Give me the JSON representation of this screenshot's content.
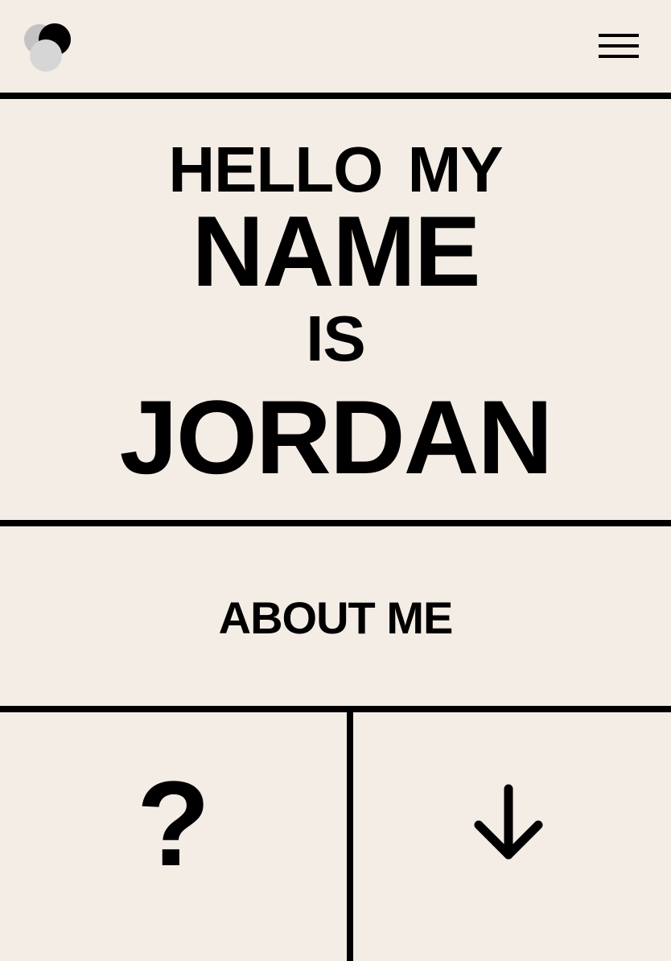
{
  "header": {
    "logo_icon": "overlapping-circles-logo",
    "menu_icon": "hamburger-menu-icon"
  },
  "hero": {
    "line1": "HELLO MY",
    "line2": "NAME",
    "line3": "IS",
    "line4": "JORDAN"
  },
  "about": {
    "label": "ABOUT ME"
  },
  "bottom": {
    "question_glyph": "?",
    "arrow_icon": "arrow-down-icon"
  },
  "colors": {
    "background": "#f4ede6",
    "ink": "#000000",
    "logo_light": "#d6d6d6",
    "logo_mid": "#b8b8b8"
  }
}
